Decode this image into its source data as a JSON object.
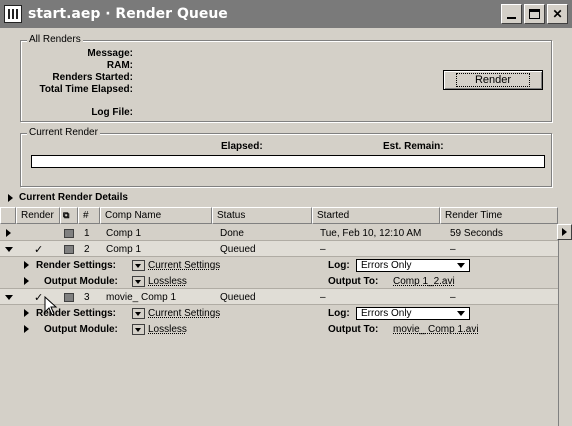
{
  "window": {
    "title": "start.aep · Render Queue"
  },
  "all_renders": {
    "legend": "All Renders",
    "labels": {
      "message": "Message:",
      "ram": "RAM:",
      "renders_started": "Renders Started:",
      "total_time_elapsed": "Total Time Elapsed:",
      "log_file": "Log File:"
    },
    "render_button": "Render"
  },
  "current_render": {
    "legend": "Current Render",
    "elapsed_label": "Elapsed:",
    "est_remain_label": "Est. Remain:"
  },
  "details_label": "Current Render Details",
  "table": {
    "headers": [
      "Render",
      "#",
      "Comp Name",
      "Status",
      "Started",
      "Render Time"
    ],
    "items": [
      {
        "num": "1",
        "comp": "Comp 1",
        "status": "Done",
        "started": "Tue, Feb 10, 12:10 AM",
        "render_time": "59 Seconds",
        "checked": false,
        "expanded": false
      },
      {
        "num": "2",
        "comp": "Comp 1",
        "status": "Queued",
        "started": "–",
        "render_time": "–",
        "checked": true,
        "expanded": true,
        "render_settings": "Current Settings",
        "output_module": "Lossless",
        "log": "Errors Only",
        "output_to": "Comp 1_2.avi"
      },
      {
        "num": "3",
        "comp": "movie_ Comp 1",
        "status": "Queued",
        "started": "–",
        "render_time": "–",
        "checked": true,
        "expanded": true,
        "render_settings": "Current Settings",
        "output_module": "Lossless",
        "log": "Errors Only",
        "output_to": "movie_ Comp 1.avi"
      }
    ],
    "labels": {
      "render_settings": "Render Settings:",
      "output_module": "Output Module:",
      "log": "Log:",
      "output_to": "Output To:"
    }
  },
  "icons": {
    "app": "ae-app-icon",
    "check": "✓",
    "cursor": "mouse-pointer-icon"
  }
}
